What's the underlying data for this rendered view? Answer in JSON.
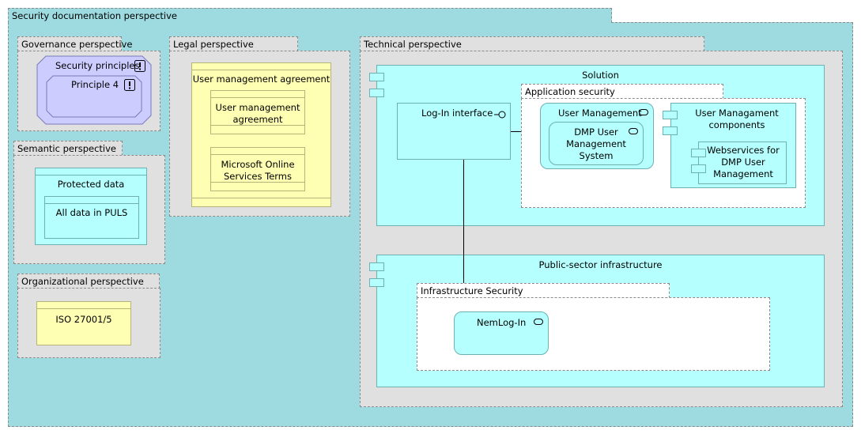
{
  "root": {
    "title": "Security documentation perspective"
  },
  "governance": {
    "title": "Governance perspective",
    "principles": "Security principles",
    "principle4": "Principle 4"
  },
  "semantic": {
    "title": "Semantic perspective",
    "protected": "Protected data",
    "alldata": "All data in PULS"
  },
  "organizational": {
    "title": "Organizational perspective",
    "iso": "ISO 27001/5"
  },
  "legal": {
    "title": "Legal perspective",
    "agreement_outer": "User management agreement",
    "agreement_inner": "User management agreement",
    "ms_terms": "Microsoft Online Services Terms"
  },
  "technical": {
    "title": "Technical perspective",
    "solution": "Solution",
    "login": "Log-In interface",
    "appsec": "Application security",
    "usermgmt": "User Management",
    "dmp": "DMP User Management System",
    "components": "User Managament components",
    "webservices": "Webservices for DMP User Management",
    "public": "Public-sector infrastructure",
    "infrasec": "Infrastructure Security",
    "nemlogin": "NemLog-In"
  },
  "colors": {
    "root_bg": "#9ddbe1",
    "gray": "#e0e0e0",
    "yellow": "#ffffb4",
    "cyan": "#b5ffff",
    "purple": "#ccccff"
  }
}
